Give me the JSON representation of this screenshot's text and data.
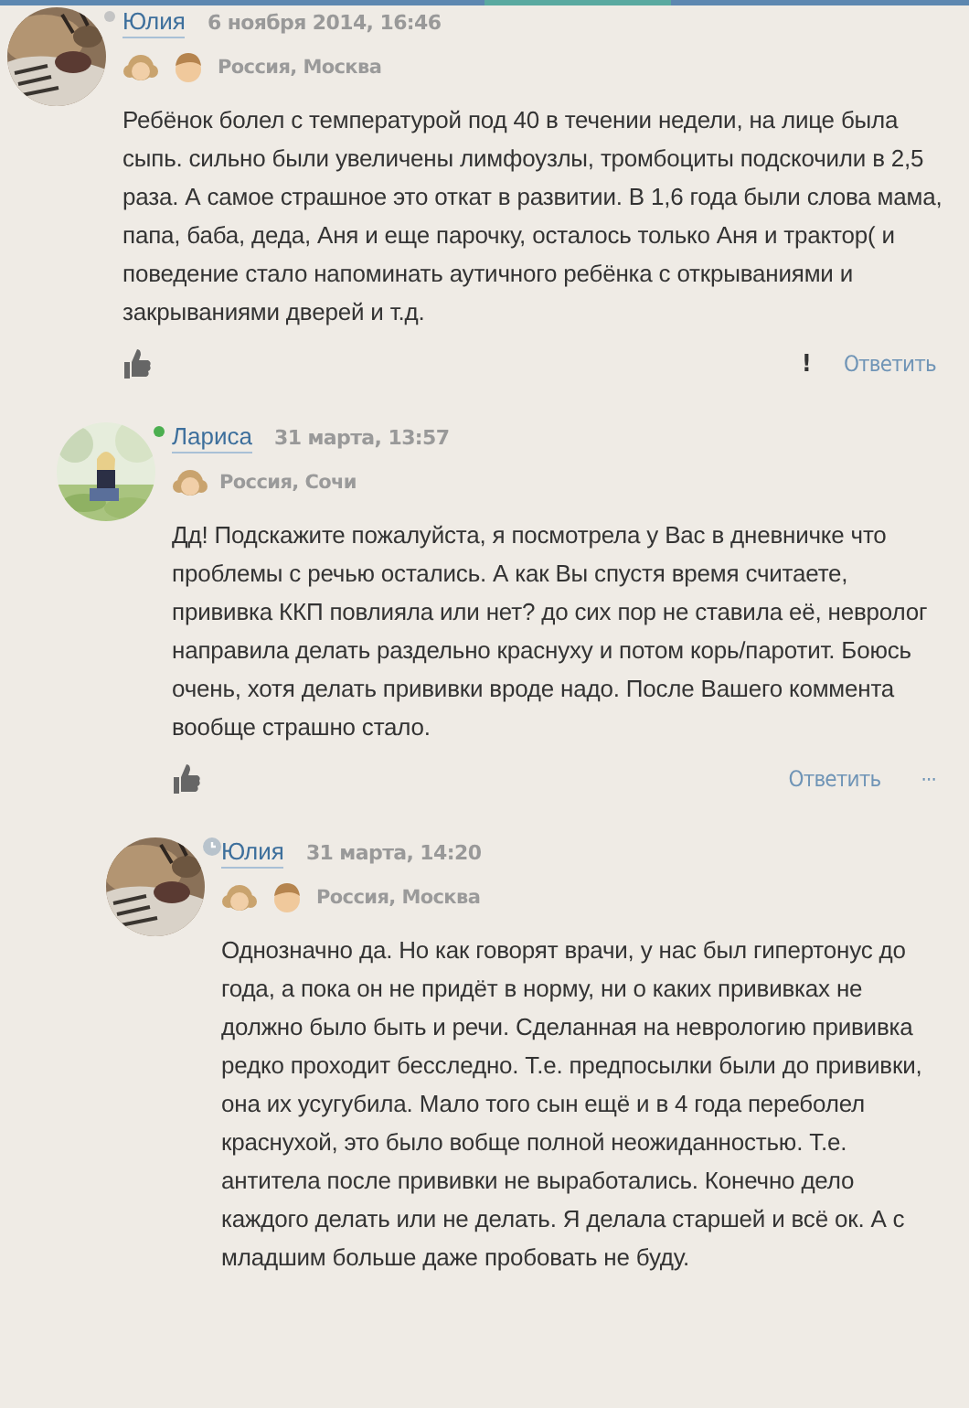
{
  "comments": [
    {
      "author": "Юлия",
      "date": "6 ноября 2014, 16:46",
      "status": {
        "kind": "offline"
      },
      "avatar": {
        "kind": "picture"
      },
      "kids": [
        {
          "kind": "girl"
        },
        {
          "kind": "boy"
        }
      ],
      "location": "Россия, Москва",
      "text": "Ребёнок болел с температурой под 40 в течении недели, на лице была сыпь. сильно были увеличены лимфоузлы, тромбоциты подскочили в 2,5 раза. А самое страшное это откат в развитии. В 1,6 года были слова мама, папа, баба, деда, Аня и еще парочку, осталось только Аня и трактор( и поведение стало напоминать аутичного ребёнка с открываниями и закрываниями дверей и т.д.",
      "actions": [
        {
          "kind": "report",
          "label": "!"
        },
        {
          "kind": "reply",
          "label": "Ответить"
        }
      ],
      "children": [
        {
          "author": "Лариса",
          "date": "31 марта, 13:57",
          "status": {
            "kind": "online"
          },
          "avatar": {
            "kind": "picture"
          },
          "kids": [
            {
              "kind": "girl"
            }
          ],
          "location": "Россия, Сочи",
          "text": "Дд! Подскажите пожалуйста, я посмотрела у Вас в дневничке что проблемы с речью остались. А как Вы спустя время считаете, прививка ККП повлияла или нет? до сих пор не ставила её, невролог направила делать раздельно краснуху и потом корь/паротит. Боюсь очень, хотя делать прививки вроде надо. После Вашего коммента вообще страшно стало.",
          "actions": [
            {
              "kind": "reply",
              "label": "Ответить"
            },
            {
              "kind": "more",
              "label": "···"
            }
          ],
          "children": [
            {
              "author": "Юлия",
              "date": "31 марта, 14:20",
              "status": {
                "kind": "away"
              },
              "avatar": {
                "kind": "picture"
              },
              "kids": [
                {
                  "kind": "girl"
                },
                {
                  "kind": "boy"
                }
              ],
              "location": "Россия, Москва",
              "text": "Однозначно да. Но как говорят врачи, у нас был гипертонус до года, а пока он не придёт в норму, ни о каких прививках не должно было быть и речи. Сделанная на неврологию прививка редко проходит бесследно. Т.е. предпосылки были до прививки, она их усугубила. Мало того сын ещё и в 4 года переболел краснухой, это было вобще полной неожиданностью. Т.е. антитела после прививки не выработались. Конечно дело каждого делать или не делать. Я делала старшей и всё ок. А с младшим больше даже пробовать не буду."
            }
          ]
        }
      ]
    }
  ]
}
